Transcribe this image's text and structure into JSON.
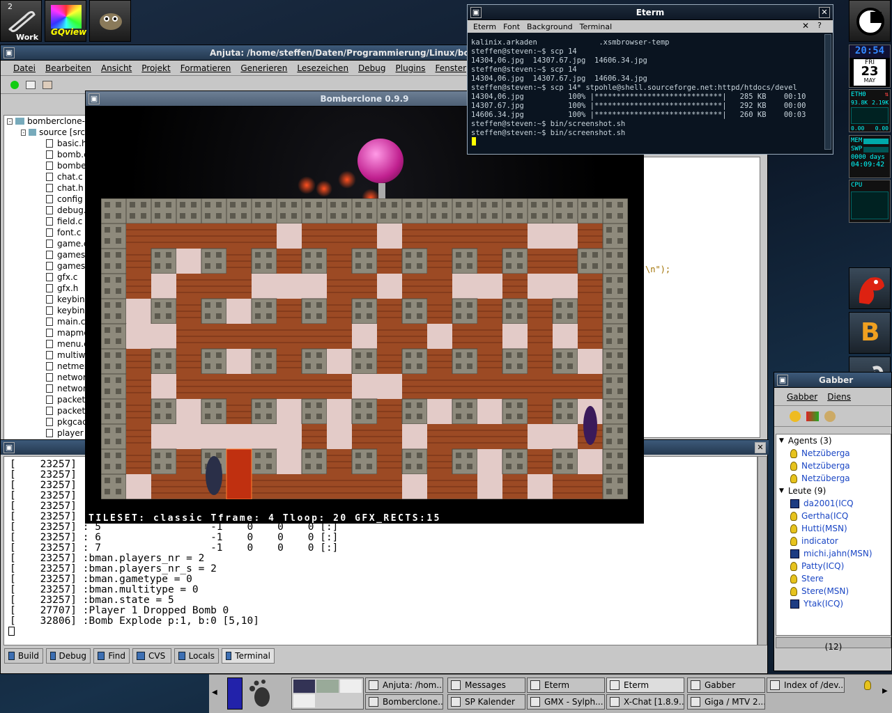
{
  "dock": {
    "work_label": "Work",
    "work_number": "2",
    "gqview_label": "GQview"
  },
  "anjuta": {
    "title": "Anjuta: /home/steffen/Daten/Programmierung/Linux/bomberclo",
    "menu": [
      "Datei",
      "Bearbeiten",
      "Ansicht",
      "Projekt",
      "Formatieren",
      "Generieren",
      "Lesezeichen",
      "Debug",
      "Plugins",
      "Fenster",
      "E"
    ],
    "tree_root": "bomberclone-",
    "tree_source": "source [src",
    "files": [
      "basic.h",
      "bomb.c",
      "bombe",
      "chat.c",
      "chat.h",
      "config",
      "debug.",
      "field.c",
      "font.c",
      "game.c",
      "games",
      "games",
      "gfx.c",
      "gfx.h",
      "keybin",
      "keybin",
      "main.c",
      "mapme",
      "menu.c",
      "multiwa",
      "netmer",
      "networ",
      "networ",
      "packet",
      "packet",
      "pkgcac",
      "player"
    ],
    "code_fragment": "\\n\");",
    "log_lines": [
      "[    23257]",
      "[    23257]",
      "[    23257]",
      "[    23257]",
      "[    23257]",
      "[    23257]",
      "[    23257] : 5                  -1    0    0    0 [:]",
      "[    23257] : 6                  -1    0    0    0 [:]",
      "[    23257] : 7                  -1    0    0    0 [:]",
      "[    23257] :bman.players_nr = 2",
      "[    23257] :bman.players_nr_s = 2",
      "[    23257] :bman.gametype = 0",
      "[    23257] :bman.multitype = 0",
      "[    23257] :bman.state = 5",
      "[    27707] :Player 1 Dropped Bomb 0",
      "[    32806] :Bomb Explode p:1, b:0 [5,10]"
    ],
    "tabs": [
      "Build",
      "Debug",
      "Find",
      "CVS",
      "Locals",
      "Terminal"
    ]
  },
  "bomberclone": {
    "title": "Bomberclone 0.9.9",
    "status": "TILESET: classic Tframe: 4 Tloop: 20 GFX_RECTS:15",
    "map": [
      "###################### ",
      "#.......  .... ........#",
      "#"
    ],
    "grid_rows": [
      "#####################",
      "#BBBBBBFBBBFBBBBBFFB#",
      "#B#F#B#B#B#B#B#B#BB#",
      "#BFBBBFFFBBFBBFFBFFB#",
      "#F#B#F#B#B#B#B#B#B#B#",
      "#FFBBBBBBBFBBFBBFBFB#",
      "#B#B#F#B#F#B#B#B#B#F#",
      "#BFBBBBBBBFFBBBBBBBB#",
      "#B#F#B#F#F#B#F#F#B#F#",
      "#BFFFFFFBFBBFBBBBFFB#",
      "#B#B#B#F#B#B#B#F#B#F#",
      "#FBBBBBBBBBBFBBFBFBB#",
      "#####################"
    ]
  },
  "eterm": {
    "title": "Eterm",
    "menu": [
      "Eterm",
      "Font",
      "Background",
      "Terminal"
    ],
    "lines": [
      "kalinix.arkaden              .xsmbrowser-temp",
      "steffen@steven:~$ scp 14",
      "14304,06.jpg  14307.67.jpg  14606.34.jpg",
      "steffen@steven:~$ scp 14",
      "14304,06.jpg  14307.67.jpg  14606.34.jpg",
      "steffen@steven:~$ scp 14* stpohle@shell.sourceforge.net:httpd/htdocs/devel",
      "14304,06.jpg          100% |*****************************|   285 KB    00:10",
      "14307.67.jpg          100% |*****************************|   292 KB    00:00",
      "14606.34.jpg          100% |*****************************|   260 KB    00:03",
      "steffen@steven:~$ bin/screenshot.sh",
      "steffen@steven:~$ bin/screenshot.sh"
    ]
  },
  "clock": {
    "time": "20:54",
    "weekday": "FRI",
    "day": "23",
    "month": "MAY"
  },
  "monitors": {
    "net_label": "ETH0",
    "net_in": "93.8K",
    "net_out": "2.19K",
    "net_bottom_left": "0.00",
    "net_bottom_right": "0.00",
    "mem": "MEM",
    "swp": "SWP",
    "uptime_days": "0000 days",
    "uptime_time": "04:09:42",
    "cpu": "CPU"
  },
  "gabber": {
    "title": "Gabber",
    "menu": [
      "Gabber",
      "Diens"
    ],
    "agents_header": "Agents (3)",
    "agents": [
      "Netzüberga",
      "Netzüberga",
      "Netzüberga"
    ],
    "leute_header": "Leute (9)",
    "leute": [
      {
        "name": "da2001(ICQ",
        "icon": "pager"
      },
      {
        "name": "Gertha(ICQ",
        "icon": "bulb"
      },
      {
        "name": "Hutti(MSN)",
        "icon": "bulb"
      },
      {
        "name": "indicator",
        "icon": "bulb"
      },
      {
        "name": "michi.jahn(MSN)",
        "icon": "pager"
      },
      {
        "name": "Patty(ICQ)",
        "icon": "bulb"
      },
      {
        "name": "Stere",
        "icon": "bulb"
      },
      {
        "name": "Stere(MSN)",
        "icon": "bulb"
      },
      {
        "name": "Ytak(ICQ)",
        "icon": "pager"
      }
    ],
    "status_count": "(12)"
  },
  "xchat_label": "xChat",
  "taskbar": {
    "top": [
      "Anjuta: /hom...",
      "Messages",
      "Eterm",
      "Eterm",
      "Gabber",
      "Index of /dev..."
    ],
    "bottom": [
      "Bomberclone...",
      "SP Kalender",
      "GMX - Sylph...",
      "X-Chat [1.8.9...",
      "Giga / MTV 2..."
    ]
  }
}
